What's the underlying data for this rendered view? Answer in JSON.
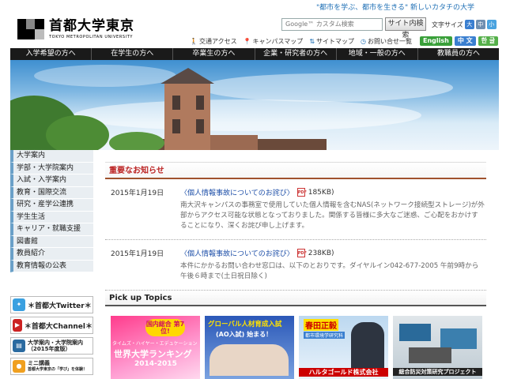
{
  "header": {
    "tagline": "\"都市を学ぶ、都市を生きる\" 新しいカタチの大学",
    "logo_jp": "首都大学東京",
    "logo_en": "TOKYO METROPOLITAN UNIVERSITY",
    "search_placeholder": "Google™ カスタム検索",
    "search_button": "サイト内検索",
    "font_size_label": "文字サイズ",
    "font_sizes": [
      "大",
      "中",
      "小"
    ],
    "utility_links": [
      "交通アクセス",
      "キャンパスマップ",
      "サイトマップ",
      "お問い合せ一覧"
    ],
    "languages": [
      "English",
      "中 文",
      "한 글"
    ]
  },
  "global_nav": [
    "入学希望の方へ",
    "在学生の方へ",
    "卒業生の方へ",
    "企業・研究者の方へ",
    "地域・一般の方へ",
    "教職員の方へ"
  ],
  "side_nav": [
    "大学案内",
    "学部・大学院案内",
    "入試・入学案内",
    "教育・国際交流",
    "研究・産学公連携",
    "学生生活",
    "キャリア・就職支援",
    "図書館",
    "教員紹介",
    "教育情報の公表"
  ],
  "side_banners": {
    "twitter": "＊首都大Twitter＊",
    "youtube": "＊首都大Channel＊",
    "guide_line1": "大学案内・大学院案内",
    "guide_line2": "（2015年度版）",
    "mini_line1": "ミニ講義",
    "mini_line2": "首都大学東京の「学び」を体験！"
  },
  "news": {
    "heading": "重要なお知らせ",
    "items": [
      {
        "date": "2015年1月19日",
        "title": "〈個人情報事故についてのお詫び〉",
        "size": "185KB)",
        "desc": "南大沢キャンパスの事務室で使用していた個人情報を含むNAS(ネットワーク接続型ストレージ)が外部からアクセス可能な状態となっておりました。関係する皆様に多大なご迷惑、ご心配をおかけすることになり、深くお詫び申し上げます。"
      },
      {
        "date": "2015年1月19日",
        "title": "〈個人情報事故についてのお詫び〉",
        "size": "238KB)",
        "desc": "本件にかかるお問い合わせ窓口は、以下のとおりです。ダイヤルイン042-677-2005 午前9時から午後６時まで(土日祝日除く)"
      }
    ]
  },
  "pickup": {
    "heading": "Pick up Topics",
    "topics": [
      {
        "badge": "国内総合 第7位!",
        "line1": "タイムズ・ハイヤー・エデュケーション",
        "line2": "世界大学ランキング",
        "line3": "2014-2015"
      },
      {
        "line1": "グローバル人材育成入試",
        "line2": "(AO入試) 始まる！"
      },
      {
        "line1": "春田正毅",
        "line2": "都市環境学研究科",
        "line3": "ハルタゴールド株式会社"
      },
      {
        "line1": "総合防災対策研究プロジェクト"
      }
    ]
  },
  "colors": {
    "accent_blue": "#1e6fb5",
    "nav_black": "#1a1a1a",
    "news_heading_red": "#bb2222",
    "english_green": "#3aa03a",
    "chinese_blue": "#3a7fd0",
    "korean_green": "#55b04a"
  }
}
